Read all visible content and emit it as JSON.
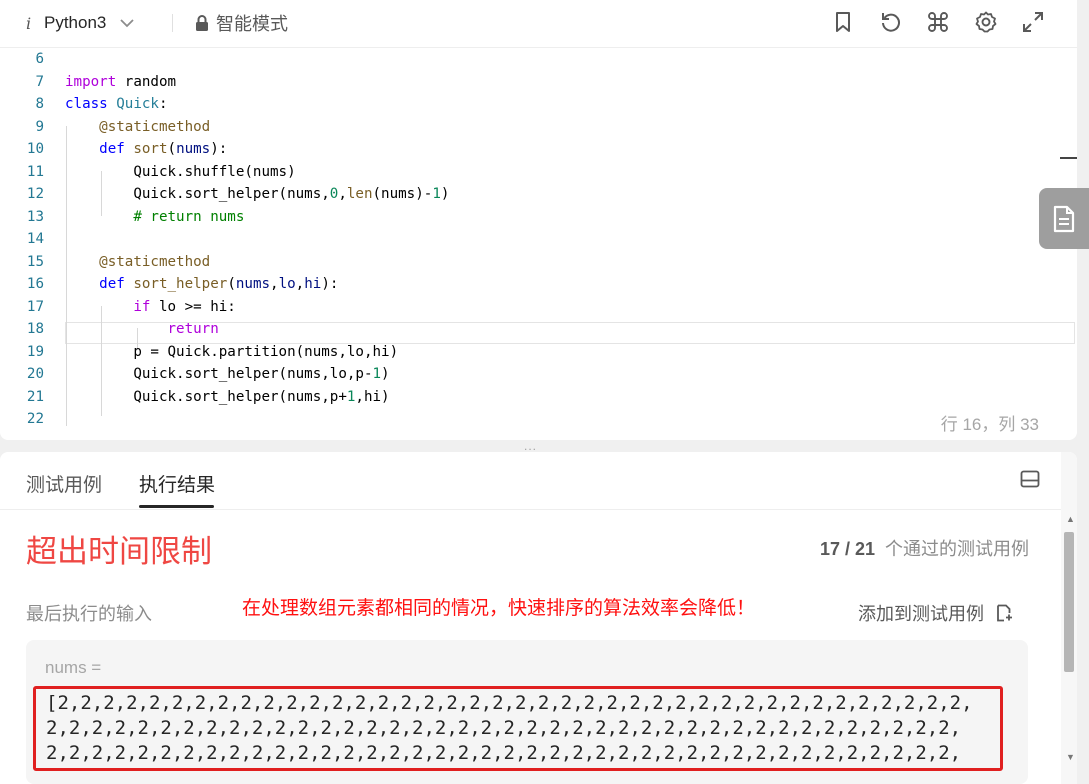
{
  "toolbar": {
    "language": "Python3",
    "mode": "智能模式",
    "icons": [
      "bookmark-icon",
      "reset-icon",
      "command-icon",
      "settings-icon",
      "fullscreen-icon"
    ]
  },
  "editor": {
    "lines": [
      {
        "n": "6",
        "code": ""
      },
      {
        "n": "7",
        "code": "import random"
      },
      {
        "n": "8",
        "code": "class Quick:"
      },
      {
        "n": "9",
        "code": "    @staticmethod"
      },
      {
        "n": "10",
        "code": "    def sort(nums):"
      },
      {
        "n": "11",
        "code": "        Quick.shuffle(nums)"
      },
      {
        "n": "12",
        "code": "        Quick.sort_helper(nums,0,len(nums)-1)"
      },
      {
        "n": "13",
        "code": "        # return nums"
      },
      {
        "n": "14",
        "code": ""
      },
      {
        "n": "15",
        "code": "    @staticmethod"
      },
      {
        "n": "16",
        "code": "    def sort_helper(nums,lo,hi):"
      },
      {
        "n": "17",
        "code": "        if lo >= hi:"
      },
      {
        "n": "18",
        "code": "            return"
      },
      {
        "n": "19",
        "code": "        p = Quick.partition(nums,lo,hi)"
      },
      {
        "n": "20",
        "code": "        Quick.sort_helper(nums,lo,p-1)"
      },
      {
        "n": "21",
        "code": "        Quick.sort_helper(nums,p+1,hi)"
      },
      {
        "n": "22",
        "code": ""
      }
    ],
    "cursor_position": "行 16，列 33",
    "resize_handle": "..."
  },
  "result": {
    "tabs": [
      "测试用例",
      "执行结果"
    ],
    "active_tab": "执行结果",
    "status": "超出时间限制",
    "status_color": "#ef4743",
    "passed_count": "17 / 21",
    "passed_label": "个通过的测试用例",
    "last_input_label": "最后执行的输入",
    "annotation": "在处理数组元素都相同的情况，快速排序的算法效率会降低！",
    "add_to_tests": "添加到测试用例",
    "input_var": "nums =",
    "input_value": "[2,2,2,2,2,2,2,2,2,2,2,2,2,2,2,2,2,2,2,2,2,2,2,2,2,2,2,2,2,2,2,2,2,2,2,2,2,2,2,2,2,2,2,2,2,2,2,2,2,2,2,2,2,2,2,2,2,2,2,2,2,2,2,2,2,2,2,2,2,2,2,2,2,2,2,2,2,2,2,2,2,2,2,2,2,2,2,2,2,2,2,2,2,2,2,2,2,2,2,2,2,2,2,2,2,2,2,2,2,2,2,2,2,2,2,2,2,2,2,2,2,2,2,2,2,2,2,2,2,2,2,2,2,2,2,2,2,2,2,2,2,2,2,2,2,2,2,2,2,2,2,2,2,2,2,2,2,2,2,2,2,2,2,2,2,2,2,2,2,2,"
  }
}
